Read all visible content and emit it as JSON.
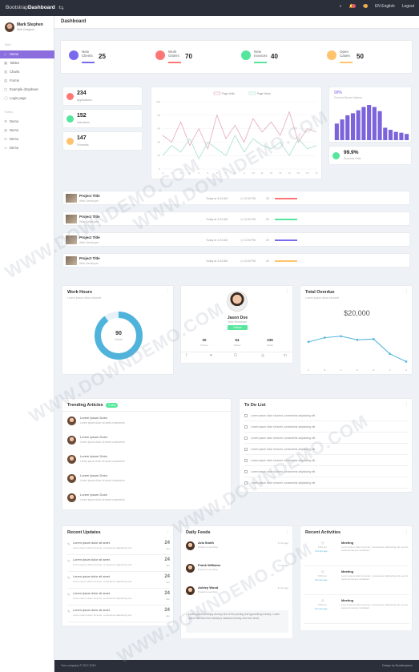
{
  "topbar": {
    "brand_prefix": "Bootstrap",
    "brand_bold": "Dashboard",
    "lang": "EN English",
    "logout": "Logout"
  },
  "sidebar": {
    "profile": {
      "name": "Mark Stephen",
      "role": "Web Designer"
    },
    "sections": [
      "Main",
      "Extras"
    ],
    "items": [
      {
        "label": "Home",
        "icon": "home-icon"
      },
      {
        "label": "Tables",
        "icon": "grid-icon"
      },
      {
        "label": "Charts",
        "icon": "bar-chart-icon"
      },
      {
        "label": "Forms",
        "icon": "padnote-icon"
      },
      {
        "label": "Example dropdown",
        "icon": "windows-icon"
      },
      {
        "label": "Login page",
        "icon": "user-icon"
      },
      {
        "label": "Demo",
        "icon": "settings-icon"
      },
      {
        "label": "Demo",
        "icon": "chart-icon"
      },
      {
        "label": "Demo",
        "icon": "mail-icon"
      },
      {
        "label": "Demo",
        "icon": "screen-icon"
      }
    ]
  },
  "page": {
    "title": "Dashboard"
  },
  "stats": [
    {
      "label1": "New",
      "label2": "Clients",
      "value": "25",
      "color": "#796AEE"
    },
    {
      "label1": "Work",
      "label2": "Orders",
      "value": "70",
      "color": "#FF7676"
    },
    {
      "label1": "New",
      "label2": "Invoices",
      "value": "40",
      "color": "#54E69D"
    },
    {
      "label1": "Open",
      "label2": "Cases",
      "value": "50",
      "color": "#FFC36D"
    }
  ],
  "mini_stats": [
    {
      "value": "234",
      "label": "Applications",
      "color": "#FF7676"
    },
    {
      "value": "152",
      "label": "Interviews",
      "color": "#54E69D"
    },
    {
      "value": "147",
      "label": "Forwards",
      "color": "#FFC36D"
    }
  ],
  "right_stats": {
    "top_value": "99%",
    "top_label": "Current Server Uptime",
    "bottom_value": "99.9%",
    "bottom_label": "Success Rate"
  },
  "chart_data": [
    {
      "type": "line",
      "series": [
        {
          "name": "Page Visits",
          "color": "#e4a9bb",
          "values": [
            50,
            40,
            70,
            35,
            60,
            30,
            80,
            45,
            65,
            40,
            75,
            55,
            70,
            50,
            85,
            40,
            60,
            55
          ]
        },
        {
          "name": "Page Views",
          "color": "#a8e0cc",
          "values": [
            20,
            35,
            25,
            45,
            15,
            40,
            30,
            20,
            50,
            25,
            45,
            35,
            30,
            40,
            20,
            45,
            30,
            35
          ]
        }
      ],
      "x": [
        "0",
        "1",
        "2",
        "3",
        "4",
        "5",
        "6",
        "7",
        "8",
        "9",
        "10",
        "11",
        "12",
        "13",
        "14",
        "15",
        "16",
        "17"
      ],
      "ylim": [
        0,
        100
      ]
    },
    {
      "type": "bar",
      "categories": [
        "1",
        "2",
        "3",
        "4",
        "5",
        "6",
        "7",
        "8",
        "9",
        "10",
        "11",
        "12",
        "13",
        "14"
      ],
      "values": [
        40,
        50,
        60,
        65,
        72,
        80,
        85,
        80,
        70,
        30,
        25,
        20,
        18,
        15
      ],
      "color": "#7b63d9"
    },
    {
      "type": "line",
      "title": "Total Overdue",
      "series": [
        {
          "name": "",
          "values": [
            32,
            38,
            40,
            35,
            36,
            15,
            4
          ]
        }
      ],
      "x": [
        "A",
        "B",
        "C",
        "D",
        "E",
        "F",
        "G"
      ],
      "ylim": [
        0,
        50
      ],
      "color": "#4fb3db"
    }
  ],
  "projects": [
    {
      "title": "Project Title",
      "sub": "Web Developer",
      "date": "Today at 4:24 AM",
      "time": "12:00 PM",
      "pct": "20",
      "color": "#FF7676"
    },
    {
      "title": "Project Title",
      "sub": "Web Developer",
      "date": "Today at 4:24 AM",
      "time": "12:00 PM",
      "pct": "20",
      "color": "#54E69D"
    },
    {
      "title": "Project Title",
      "sub": "Web Developer",
      "date": "Today at 4:24 AM",
      "time": "12:00 PM",
      "pct": "20",
      "color": "#796AEE"
    },
    {
      "title": "Project Title",
      "sub": "Web Developer",
      "date": "Today at 4:24 AM",
      "time": "12:00 PM",
      "pct": "20",
      "color": "#FFC36D"
    }
  ],
  "work_hours": {
    "title": "Work Hours",
    "sub": "Lorem ipsum dolor sit amet",
    "value": "90",
    "unit": "Hours",
    "progress": 0.9
  },
  "user_card": {
    "name": "Jason Doe",
    "role": "Web Developer",
    "button": "Follow",
    "stats": [
      {
        "value": "20",
        "label": "Photos"
      },
      {
        "value": "54",
        "label": "Videos"
      },
      {
        "value": "235",
        "label": "Tasks"
      }
    ]
  },
  "overdue": {
    "title": "Total Overdue",
    "sub": "Lorem ipsum dolor sit amet",
    "amount": "$20,000"
  },
  "trending": {
    "title": "Trending Articles",
    "badge": "4 new",
    "items": [
      {
        "title": "Lorem Ipsum Dolor",
        "sub": "Lorem ipsum dolor sit amet consectetur"
      },
      {
        "title": "Lorem Ipsum Dolor",
        "sub": "Lorem ipsum dolor sit amet consectetur"
      },
      {
        "title": "Lorem Ipsum Dolor",
        "sub": "Lorem ipsum dolor sit amet consectetur"
      },
      {
        "title": "Lorem Ipsum Dolor",
        "sub": "Lorem ipsum dolor sit amet consectetur"
      },
      {
        "title": "Lorem Ipsum Dolor",
        "sub": "Lorem ipsum dolor sit amet consectetur"
      }
    ]
  },
  "todo": {
    "title": "To Do List",
    "items": [
      "Lorem ipsum dolor sit amet, consectetur adipisicing elit.",
      "Lorem ipsum dolor sit amet, consectetur adipisicing elit.",
      "Lorem ipsum dolor sit amet, consectetur adipisicing elit.",
      "Lorem ipsum dolor sit amet, consectetur adipisicing elit.",
      "Lorem ipsum dolor sit amet, consectetur adipisicing elit.",
      "Lorem ipsum dolor sit amet, consectetur adipisicing elit.",
      "Lorem ipsum dolor sit amet, consectetur adipisicing elit."
    ]
  },
  "updates": {
    "title": "Recent Updates",
    "items": [
      {
        "title": "Lorem ipsum dolor sit amet.",
        "sub": "Lorem ipsum dolor sit amet, consectetur adipisicing elit.",
        "day": "24",
        "month": "Jan"
      },
      {
        "title": "Lorem ipsum dolor sit amet.",
        "sub": "Lorem ipsum dolor sit amet, consectetur adipisicing elit.",
        "day": "24",
        "month": "Jan"
      },
      {
        "title": "Lorem ipsum dolor sit amet.",
        "sub": "Lorem ipsum dolor sit amet, consectetur adipisicing elit.",
        "day": "24",
        "month": "Jan"
      },
      {
        "title": "Lorem ipsum dolor sit amet.",
        "sub": "Lorem ipsum dolor sit amet, consectetur adipisicing elit.",
        "day": "24",
        "month": "Jan"
      },
      {
        "title": "Lorem ipsum dolor sit amet.",
        "sub": "Lorem ipsum dolor sit amet, consectetur adipisicing elit.",
        "day": "24",
        "month": "Jan"
      }
    ]
  },
  "feeds": {
    "title": "Daily Feeds",
    "items": [
      {
        "name": "Aria Smith",
        "sub": "Posted a new blog",
        "time": "5 min ago"
      },
      {
        "name": "Frank Williams",
        "sub": "Posted a new blog",
        "time": "5 min ago"
      },
      {
        "name": "Ashley Wood",
        "sub": "Posted a new blog",
        "time": "5 min ago"
      }
    ],
    "quote": "Lorem ipsum is simply dummy text of the printing and typesetting industry. Lorem Ipsum has been the industry's standard dummy text ever since."
  },
  "activities": {
    "title": "Recent Activities",
    "items": [
      {
        "when": "6:00 am",
        "ago": "6 hours ago",
        "title": "Meeting",
        "text": "Lorem ipsum dolor sit amet, consectetur adipisicing elit, sed do eiusmod tempor incididunt."
      },
      {
        "when": "6:00 am",
        "ago": "6 hours ago",
        "title": "Meeting",
        "text": "Lorem ipsum dolor sit amet, consectetur adipisicing elit, sed do eiusmod tempor incididunt."
      },
      {
        "when": "6:00 am",
        "ago": "6 hours ago",
        "title": "Meeting",
        "text": "Lorem ipsum dolor sit amet, consectetur adipisicing elit, sed do eiusmod tempor incididunt."
      }
    ]
  },
  "footer": {
    "left": "Your company © 2017-2019",
    "right": "Design by Bootstrapious"
  },
  "watermark": "WWW.DOWNDEMO.COM"
}
